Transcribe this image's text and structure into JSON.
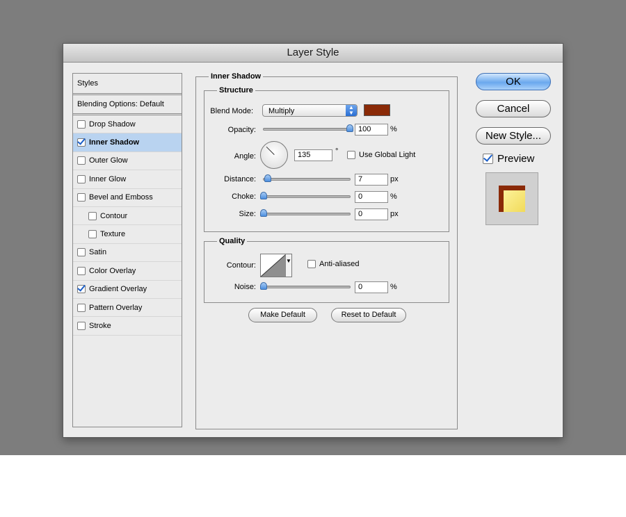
{
  "window": {
    "title": "Layer Style"
  },
  "styles_panel": {
    "header": "Styles",
    "blending_options": "Blending Options: Default",
    "items": [
      {
        "label": "Drop Shadow",
        "checked": false,
        "selected": false,
        "indent": false
      },
      {
        "label": "Inner Shadow",
        "checked": true,
        "selected": true,
        "indent": false
      },
      {
        "label": "Outer Glow",
        "checked": false,
        "selected": false,
        "indent": false
      },
      {
        "label": "Inner Glow",
        "checked": false,
        "selected": false,
        "indent": false
      },
      {
        "label": "Bevel and Emboss",
        "checked": false,
        "selected": false,
        "indent": false
      },
      {
        "label": "Contour",
        "checked": false,
        "selected": false,
        "indent": true
      },
      {
        "label": "Texture",
        "checked": false,
        "selected": false,
        "indent": true
      },
      {
        "label": "Satin",
        "checked": false,
        "selected": false,
        "indent": false
      },
      {
        "label": "Color Overlay",
        "checked": false,
        "selected": false,
        "indent": false
      },
      {
        "label": "Gradient Overlay",
        "checked": true,
        "selected": false,
        "indent": false
      },
      {
        "label": "Pattern Overlay",
        "checked": false,
        "selected": false,
        "indent": false
      },
      {
        "label": "Stroke",
        "checked": false,
        "selected": false,
        "indent": false
      }
    ]
  },
  "inner_shadow": {
    "title": "Inner Shadow",
    "structure": {
      "title": "Structure",
      "blend_mode_label": "Blend Mode:",
      "blend_mode_value": "Multiply",
      "shadow_color": "#8a2a07",
      "opacity_label": "Opacity:",
      "opacity_value": "100",
      "opacity_unit": "%",
      "opacity_fraction": 1.0,
      "angle_label": "Angle:",
      "angle_value": "135",
      "angle_unit": "°",
      "use_global_light_label": "Use Global Light",
      "use_global_light_checked": false,
      "distance_label": "Distance:",
      "distance_value": "7",
      "distance_unit": "px",
      "distance_fraction": 0.05,
      "choke_label": "Choke:",
      "choke_value": "0",
      "choke_unit": "%",
      "choke_fraction": 0,
      "size_label": "Size:",
      "size_value": "0",
      "size_unit": "px",
      "size_fraction": 0
    },
    "quality": {
      "title": "Quality",
      "contour_label": "Contour:",
      "anti_aliased_label": "Anti-aliased",
      "anti_aliased_checked": false,
      "noise_label": "Noise:",
      "noise_value": "0",
      "noise_unit": "%",
      "noise_fraction": 0
    },
    "make_default_label": "Make Default",
    "reset_default_label": "Reset to Default"
  },
  "actions": {
    "ok_label": "OK",
    "cancel_label": "Cancel",
    "new_style_label": "New Style...",
    "preview_label": "Preview",
    "preview_checked": true
  },
  "colors": {
    "selection": "#b9d3f0",
    "accent": "#4c8fe0",
    "preview_fill": "#f1da5a"
  }
}
